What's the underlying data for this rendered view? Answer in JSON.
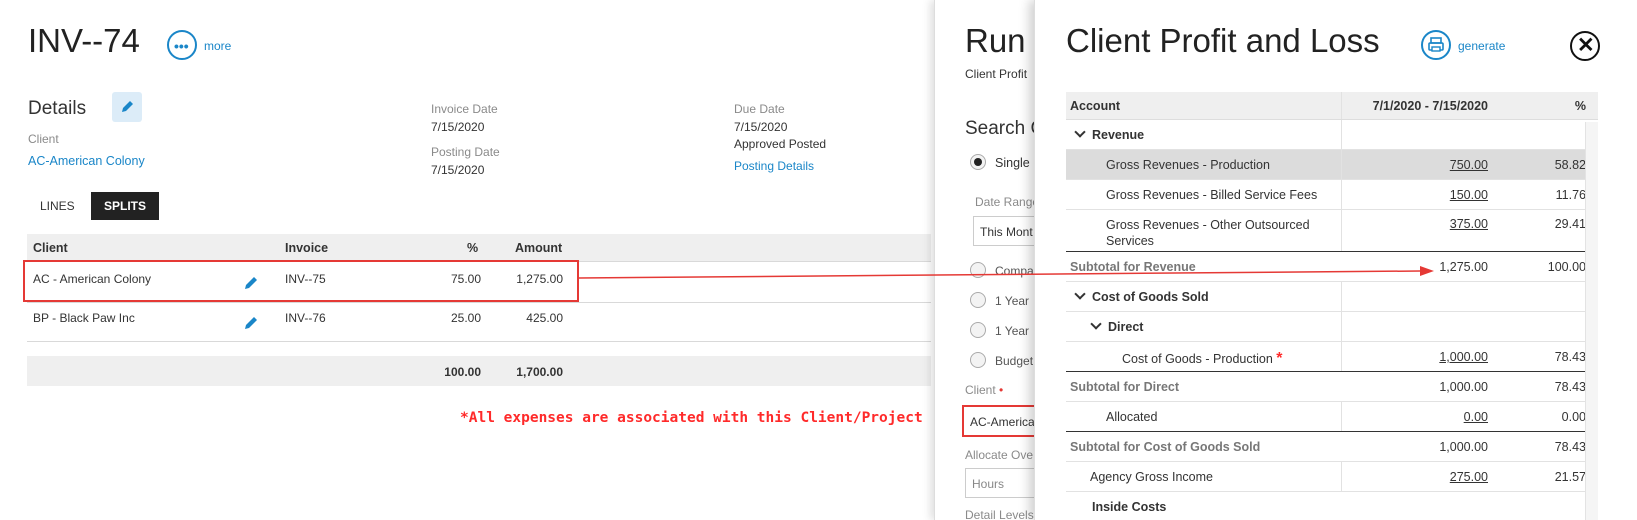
{
  "invoice": {
    "title": "INV--74",
    "more_label": "more",
    "details_heading": "Details",
    "client_label": "Client",
    "client_value": "AC-American Colony",
    "invoice_date_label": "Invoice Date",
    "invoice_date_value": "7/15/2020",
    "posting_date_label": "Posting Date",
    "posting_date_value": "7/15/2020",
    "due_date_label": "Due Date",
    "due_date_value": "7/15/2020",
    "status_value": "Approved Posted",
    "posting_details_link": "Posting Details",
    "tabs": [
      "LINES",
      "SPLITS"
    ],
    "table_headers": [
      "Client",
      "Invoice",
      "%",
      "Amount"
    ],
    "rows": [
      {
        "client": "AC - American Colony",
        "invoice": "INV--75",
        "pct": "75.00",
        "amount": "1,275.00"
      },
      {
        "client": "BP - Black Paw Inc",
        "invoice": "INV--76",
        "pct": "25.00",
        "amount": "425.00"
      }
    ],
    "totals": {
      "pct": "100.00",
      "amount": "1,700.00"
    },
    "annotation": "*All expenses are associated with this Client/Project"
  },
  "run_panel": {
    "title": "Run",
    "subtitle": "Client Profit",
    "search_heading": "Search C",
    "single_label": "Single I",
    "date_range_label": "Date Range",
    "date_range_value": "This Mont",
    "options": [
      "Compa",
      "1 Year",
      "1 Year",
      "Budget"
    ],
    "client_label": "Client",
    "client_value": "AC-America",
    "allocate_label": "Allocate Ove",
    "allocate_value": "Hours",
    "detail_levels_label": "Detail Levels"
  },
  "pl_panel": {
    "title": "Client Profit and Loss",
    "generate_label": "generate",
    "headers": {
      "account": "Account",
      "period": "7/1/2020 - 7/15/2020",
      "pct": "%"
    },
    "rows": [
      {
        "label": "Revenue",
        "amount": "",
        "pct": ""
      },
      {
        "label": "Gross Revenues - Production",
        "amount": "750.00",
        "pct": "58.82"
      },
      {
        "label": "Gross Revenues - Billed Service Fees",
        "amount": "150.00",
        "pct": "11.76"
      },
      {
        "label": "Gross Revenues - Other Outsourced Services",
        "amount": "375.00",
        "pct": "29.41"
      },
      {
        "label": "Subtotal for Revenue",
        "amount": "1,275.00",
        "pct": "100.00"
      },
      {
        "label": "Cost of Goods Sold",
        "amount": "",
        "pct": ""
      },
      {
        "label": "Direct",
        "amount": "",
        "pct": ""
      },
      {
        "label": "Cost of Goods - Production",
        "amount": "1,000.00",
        "pct": "78.43"
      },
      {
        "label": "Subtotal for Direct",
        "amount": "1,000.00",
        "pct": "78.43"
      },
      {
        "label": "Allocated",
        "amount": "0.00",
        "pct": "0.00"
      },
      {
        "label": "Subtotal for Cost of Goods Sold",
        "amount": "1,000.00",
        "pct": "78.43"
      },
      {
        "label": "Agency Gross Income",
        "amount": "275.00",
        "pct": "21.57"
      },
      {
        "label": "Inside Costs",
        "amount": "",
        "pct": ""
      }
    ],
    "star_mark": "*"
  },
  "colors": {
    "accent": "#1a86c8",
    "annotation": "#ff2a2a",
    "highlight_box": "#e53935"
  }
}
